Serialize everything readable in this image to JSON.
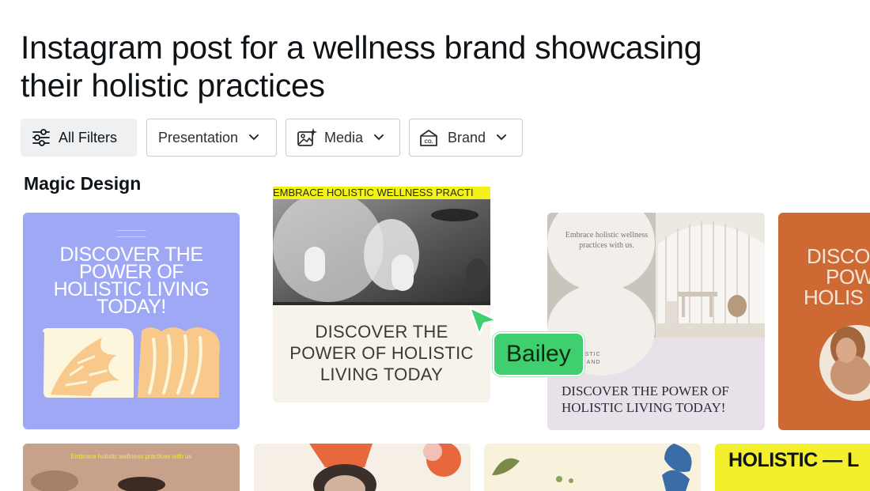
{
  "page": {
    "title_line1": "Instagram post for a wellness brand showcasing",
    "title_line2": "their holistic practices"
  },
  "filters": {
    "all_filters_label": "All Filters",
    "presentation_label": "Presentation",
    "media_label": "Media",
    "brand_label": "Brand",
    "chevron_icon": "chevron-down-icon",
    "filters_icon": "sliders-icon",
    "media_icon": "image-sparkle-icon",
    "brand_icon": "brand-kit-icon"
  },
  "section": {
    "title": "Magic Design"
  },
  "cards": [
    {
      "heading_lines": [
        "DISCOVER THE",
        "POWER OF",
        "HOLISTIC LIVING",
        "TODAY!"
      ],
      "bg": "#9fa8f5"
    },
    {
      "ticker": "EMBRACE HOLISTIC WELLNESS PRACTI",
      "heading_lines": [
        "DISCOVER THE",
        "POWER OF HOLISTIC",
        "LIVING TODAY"
      ],
      "ticker_bg": "#f2f21a"
    },
    {
      "small_text": "Embrace holistic wellness practices with us.",
      "caps_lines": [
        "G HOLISTIC",
        "ESS BRAND"
      ],
      "heading_lines": [
        "DISCOVER THE POWER OF",
        "HOLISTIC LIVING TODAY!"
      ]
    },
    {
      "heading_lines": [
        "DISCO",
        "POW",
        "HOLIS"
      ],
      "bg": "#cf6934"
    }
  ],
  "bottom_cards": [
    {
      "tiny": "Embrace holistic wellness practices with us"
    },
    {},
    {},
    {
      "word": "HOLISTIC —  L"
    }
  ],
  "collaborator": {
    "name": "Bailey",
    "color": "#3fcf6e"
  }
}
